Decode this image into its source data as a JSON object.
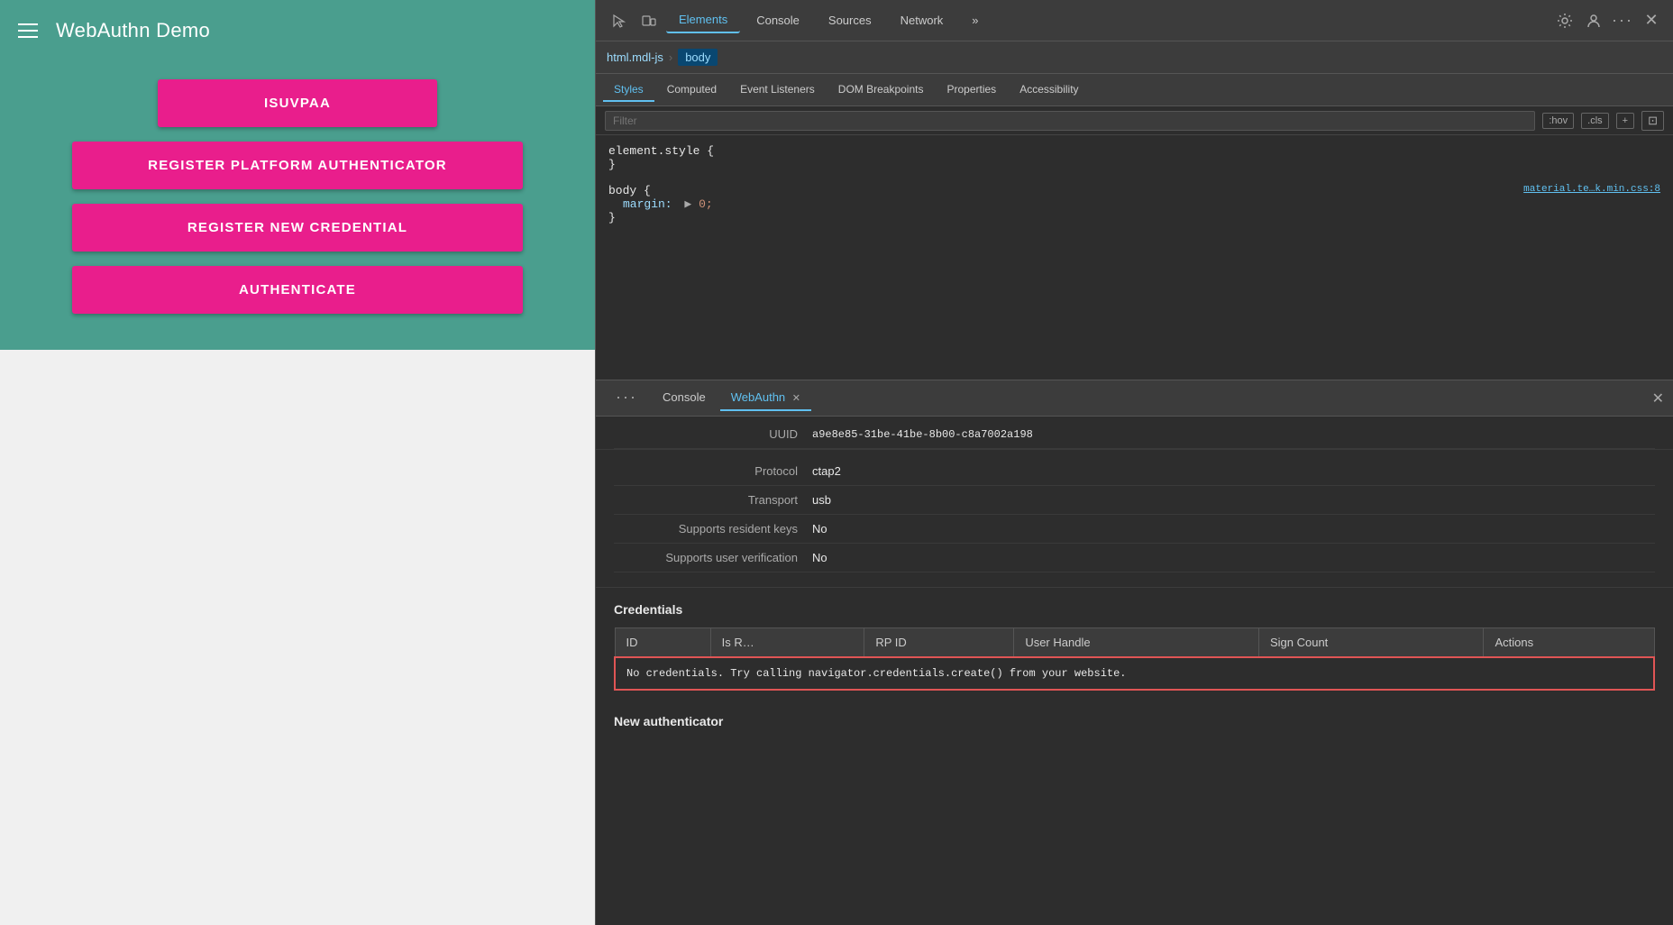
{
  "app": {
    "title": "WebAuthn Demo",
    "header_bg": "#4a9e8e",
    "buttons": [
      {
        "id": "btn-isuvpaa",
        "label": "ISUVPAA"
      },
      {
        "id": "btn-register-platform",
        "label": "REGISTER PLATFORM AUTHENTICATOR"
      },
      {
        "id": "btn-register-credential",
        "label": "REGISTER NEW CREDENTIAL"
      },
      {
        "id": "btn-authenticate",
        "label": "AUTHENTICATE"
      }
    ]
  },
  "devtools": {
    "tabs": [
      {
        "label": "Elements",
        "active": true
      },
      {
        "label": "Console",
        "active": false
      },
      {
        "label": "Sources",
        "active": false
      },
      {
        "label": "Network",
        "active": false
      },
      {
        "label": "»",
        "active": false
      }
    ],
    "breadcrumb": [
      {
        "label": "html.mdl-js",
        "active": false
      },
      {
        "label": "body",
        "active": true
      }
    ],
    "styles_tabs": [
      {
        "label": "Styles",
        "active": true
      },
      {
        "label": "Computed",
        "active": false
      },
      {
        "label": "Event Listeners",
        "active": false
      },
      {
        "label": "DOM Breakpoints",
        "active": false
      },
      {
        "label": "Properties",
        "active": false
      },
      {
        "label": "Accessibility",
        "active": false
      }
    ],
    "filter_placeholder": "Filter",
    "filter_buttons": [
      ":hov",
      ".cls",
      "+"
    ],
    "css_rules": [
      {
        "selector": "element.style {",
        "close": "}",
        "source": "",
        "properties": []
      },
      {
        "selector": "body {",
        "close": "}",
        "source": "material.te…k.min.css:8",
        "properties": [
          {
            "name": "margin:",
            "value": "▶ 0;"
          }
        ]
      }
    ],
    "lower_tabs": [
      {
        "label": "···",
        "active": false,
        "closeable": false
      },
      {
        "label": "Console",
        "active": false,
        "closeable": false
      },
      {
        "label": "WebAuthn",
        "active": true,
        "closeable": true
      }
    ],
    "authenticator": {
      "partial_uuid_label": "UUID",
      "partial_uuid_value": "a9e8e85-31be-41be-8b00-c8a7002a198",
      "rows": [
        {
          "label": "Protocol",
          "value": "ctap2"
        },
        {
          "label": "Transport",
          "value": "usb"
        },
        {
          "label": "Supports resident keys",
          "value": "No"
        },
        {
          "label": "Supports user verification",
          "value": "No"
        }
      ]
    },
    "credentials": {
      "title": "Credentials",
      "columns": [
        "ID",
        "Is R…",
        "RP ID",
        "User Handle",
        "Sign Count",
        "Actions"
      ],
      "no_credentials_prefix": "No credentials. Try calling ",
      "no_credentials_code": "navigator.credentials.create()",
      "no_credentials_suffix": " from your website."
    },
    "new_authenticator": {
      "title": "New authenticator"
    }
  }
}
